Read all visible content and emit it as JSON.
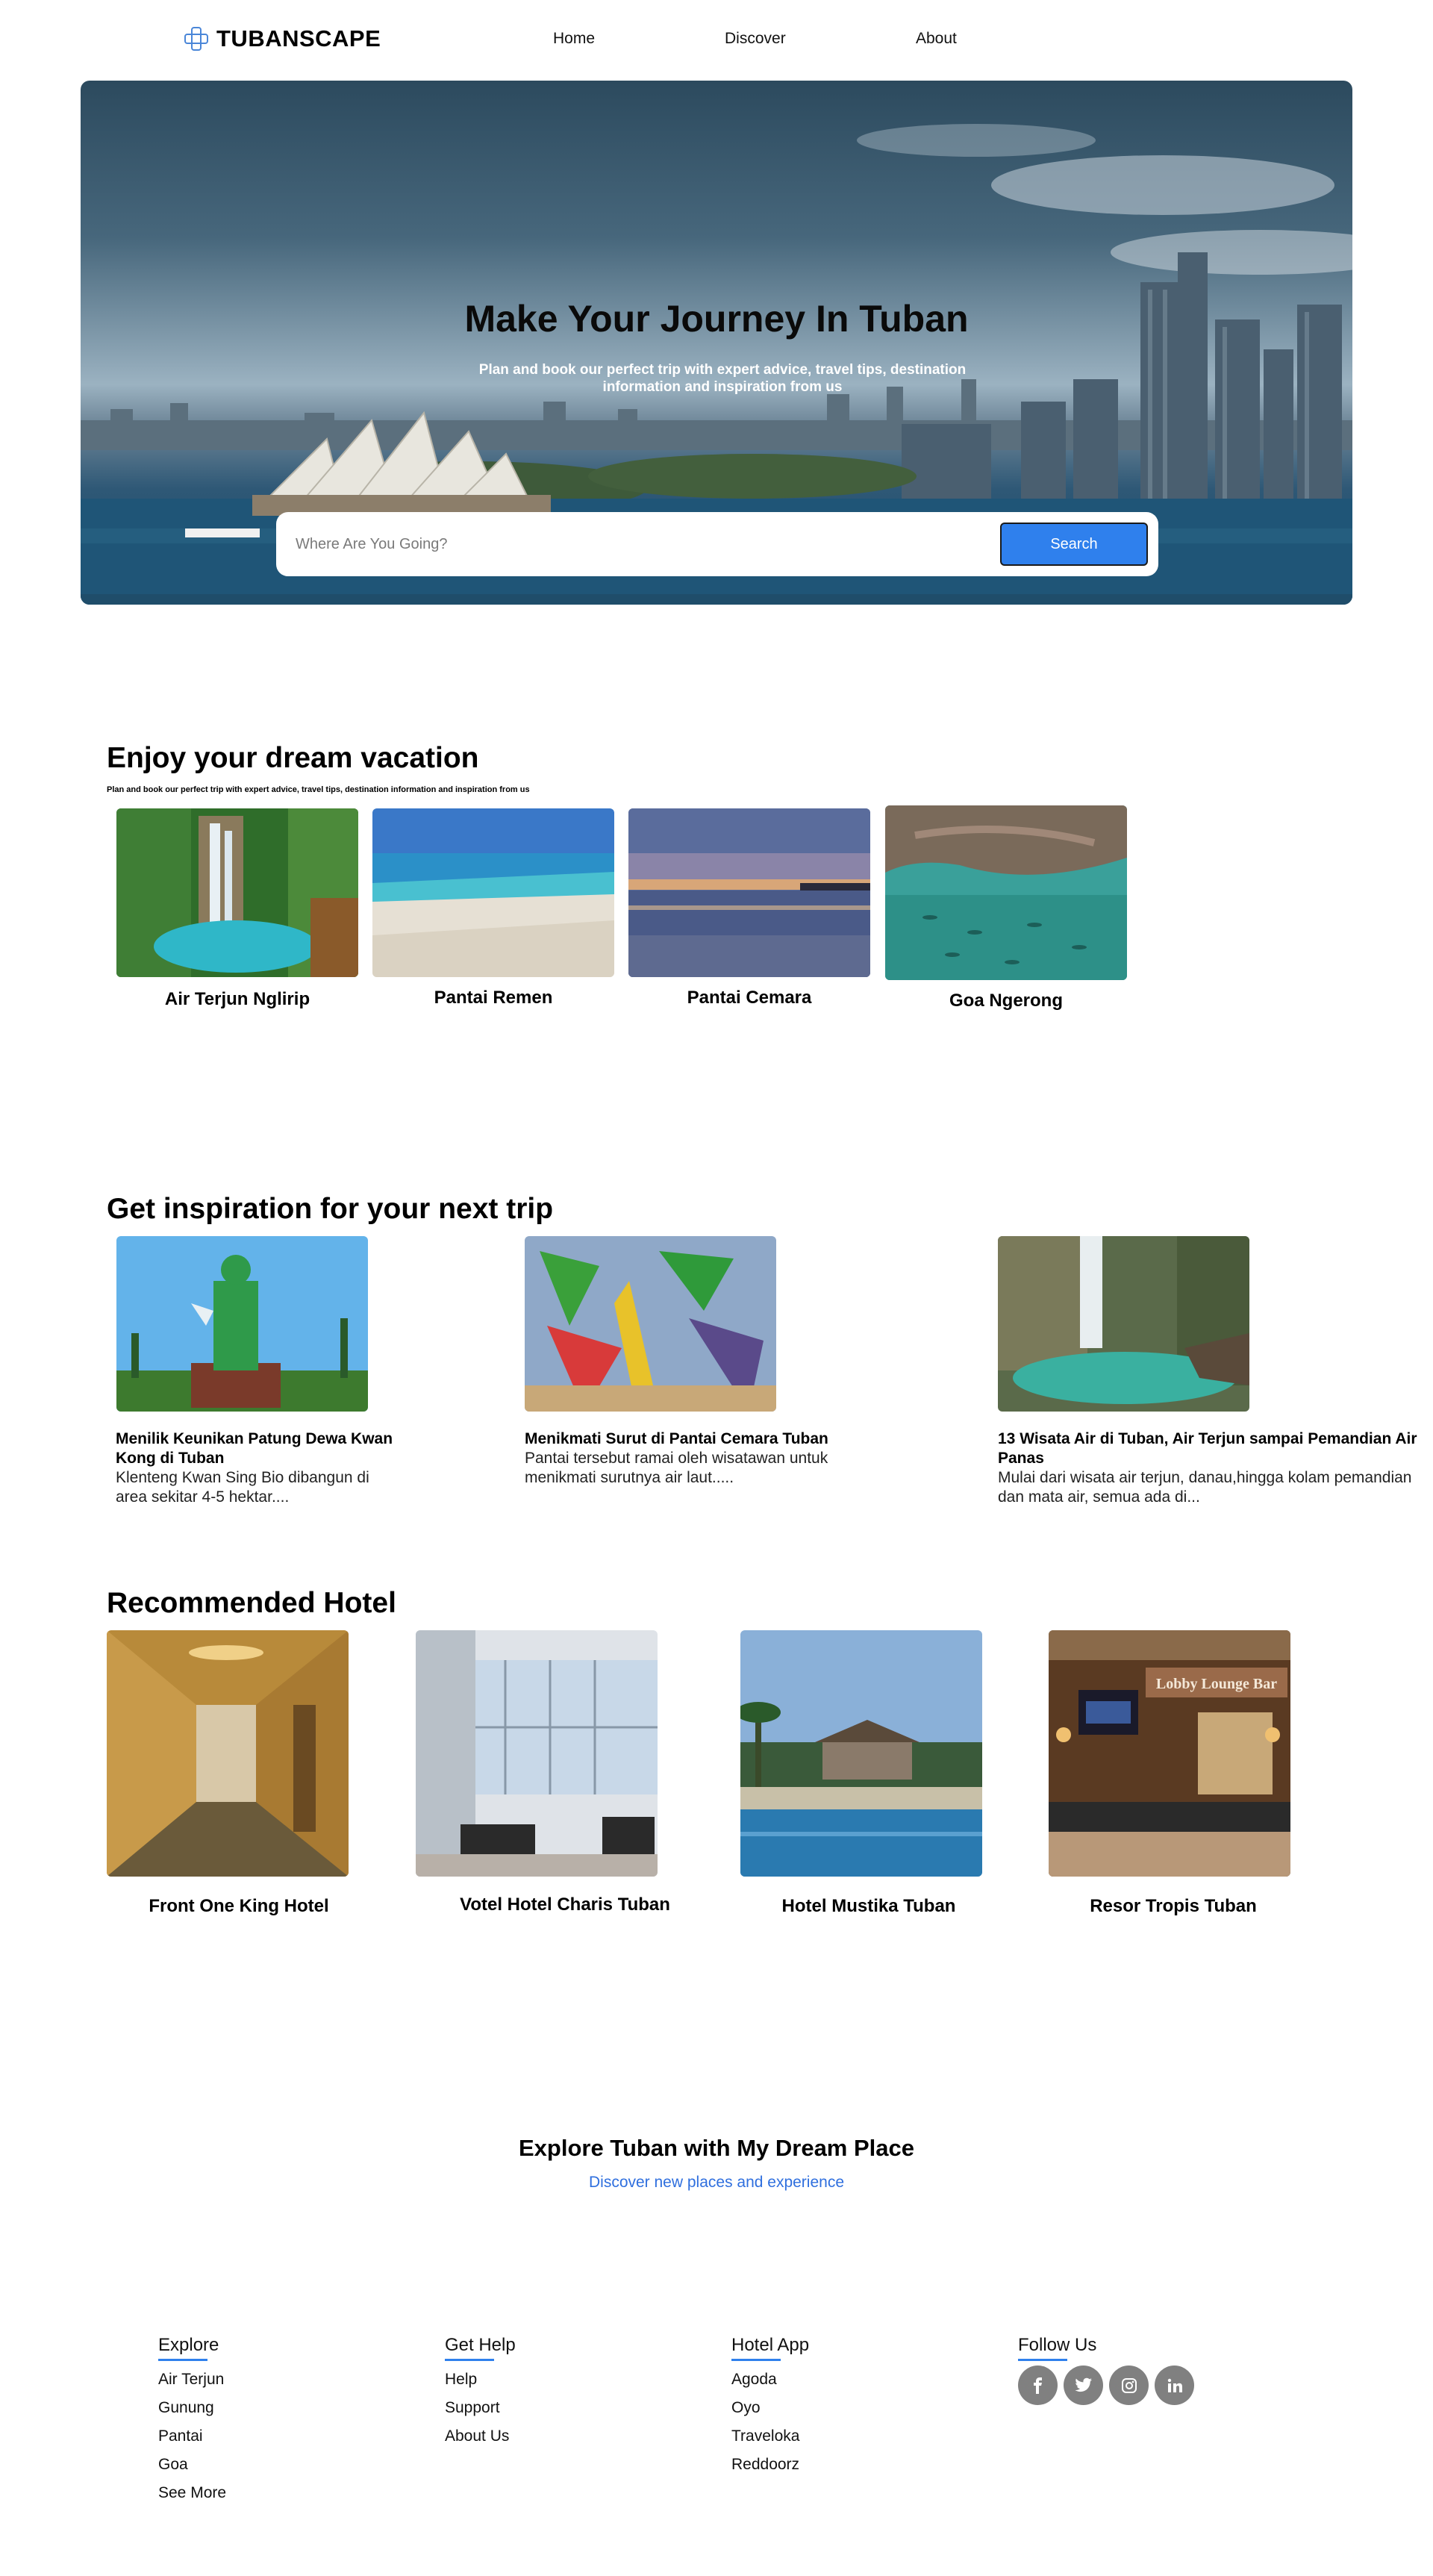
{
  "nav": {
    "brand": "TUBANSCAPE",
    "links": [
      "Home",
      "Discover",
      "About"
    ]
  },
  "hero": {
    "title": "Make Your Journey In Tuban",
    "subtitle": "Plan and book our perfect trip with expert advice, travel tips, destination information and inspiration from us",
    "search_placeholder": "Where Are You Going?",
    "search_button": "Search"
  },
  "vacation": {
    "title": "Enjoy your dream vacation",
    "subtitle": "Plan and book our perfect trip with expert advice, travel tips, destination information and inspiration from us",
    "places": [
      "Air Terjun Nglirip",
      "Pantai Remen",
      "Pantai Cemara",
      "Goa Ngerong"
    ]
  },
  "inspiration": {
    "title": "Get inspiration for your next trip",
    "articles": [
      {
        "title": "Menilik Keunikan Patung Dewa Kwan Kong di Tuban",
        "text": "Klenteng Kwan Sing Bio dibangun di area sekitar 4-5 hektar...."
      },
      {
        "title": "Menikmati Surut di Pantai Cemara Tuban",
        "text": "Pantai tersebut ramai oleh wisatawan untuk menikmati surutnya air laut....."
      },
      {
        "title": "13 Wisata Air di Tuban, Air Terjun sampai Pemandian Air Panas",
        "text": "Mulai dari wisata air terjun, danau,hingga kolam pemandian dan mata air, semua ada di..."
      }
    ]
  },
  "hotels": {
    "title": "Recommended Hotel",
    "items": [
      "Front One King Hotel",
      "Votel Hotel Charis Tuban",
      "Hotel Mustika Tuban",
      "Resor Tropis Tuban"
    ],
    "bar_sign": "Lobby Lounge Bar"
  },
  "explore": {
    "title": "Explore Tuban with My Dream Place",
    "subtitle": "Discover new places and experience"
  },
  "footer": {
    "explore": {
      "head": "Explore",
      "links": [
        "Air Terjun",
        "Gunung",
        "Pantai",
        "Goa",
        "See More"
      ]
    },
    "help": {
      "head": "Get Help",
      "links": [
        "Help",
        "Support",
        "About Us"
      ]
    },
    "app": {
      "head": "Hotel App",
      "links": [
        "Agoda",
        "Oyo",
        "Traveloka",
        "Reddoorz"
      ]
    },
    "follow": {
      "head": "Follow Us",
      "icons": [
        "facebook-icon",
        "twitter-icon",
        "instagram-icon",
        "linkedin-icon"
      ]
    }
  },
  "colors": {
    "accent": "#2f80ed",
    "link": "#2f6fde",
    "social": "#808080"
  }
}
